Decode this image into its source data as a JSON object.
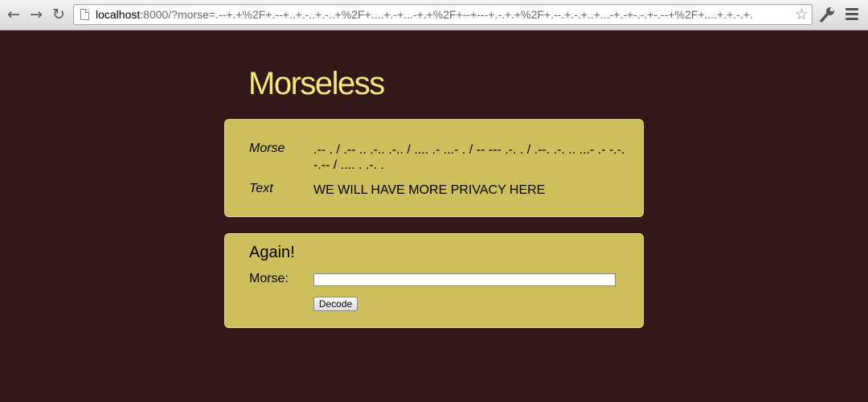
{
  "browser": {
    "back_icon": "←",
    "forward_icon": "→",
    "reload_icon": "↻",
    "url_host": "localhost",
    "url_rest": ":8000/?morse=.--+.+%2F+.--+..+.-..+.-..+%2F+....+.-+...-+.+%2F+--+---+.-.+.+%2F+.--.+.-.+..+...-+.-+-.-.+-.--+%2F+....+.+.-.+.",
    "star_icon": "☆"
  },
  "page": {
    "title": "Morseless"
  },
  "result": {
    "morse_label": "Morse",
    "morse_value": ".-- . / .-- .. .-.. .-.. / .... .- ...- . / -- --- .-. . / .--. .-. .. ...- .- -.-. -.-- / .... . .-. .",
    "text_label": "Text",
    "text_value": "WE WILL HAVE MORE PRIVACY HERE"
  },
  "again": {
    "title": "Again!",
    "morse_label": "Morse:",
    "input_value": "",
    "button_label": "Decode"
  }
}
